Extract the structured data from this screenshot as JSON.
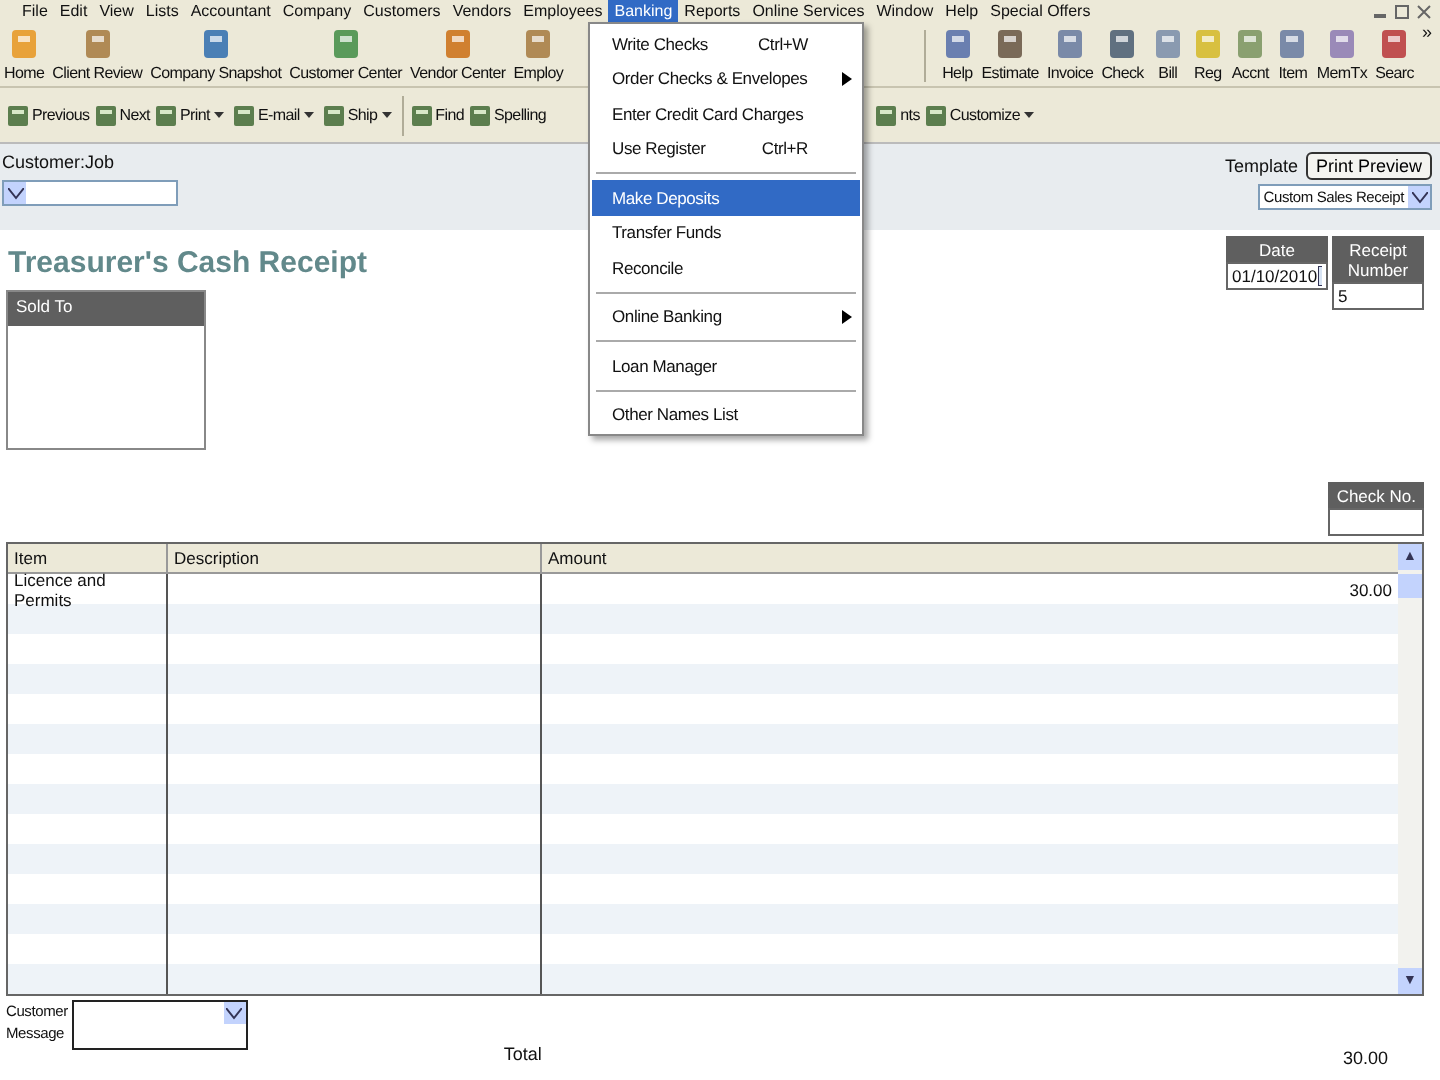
{
  "menu_bar": [
    {
      "label": "File",
      "selected": false
    },
    {
      "label": "Edit",
      "selected": false
    },
    {
      "label": "View",
      "selected": false
    },
    {
      "label": "Lists",
      "selected": false
    },
    {
      "label": "Accountant",
      "selected": false
    },
    {
      "label": "Company",
      "selected": false
    },
    {
      "label": "Customers",
      "selected": false
    },
    {
      "label": "Vendors",
      "selected": false
    },
    {
      "label": "Employees",
      "selected": false
    },
    {
      "label": "Banking",
      "selected": true
    },
    {
      "label": "Reports",
      "selected": false
    },
    {
      "label": "Online Services",
      "selected": false
    },
    {
      "label": "Window",
      "selected": false
    },
    {
      "label": "Help",
      "selected": false
    },
    {
      "label": "Special Offers",
      "selected": false
    }
  ],
  "icon_bar_left": [
    {
      "label": "Home"
    },
    {
      "label": "Client Review"
    },
    {
      "label": "Company Snapshot"
    },
    {
      "label": "Customer Center"
    },
    {
      "label": "Vendor Center"
    },
    {
      "label": "Employ"
    }
  ],
  "icon_bar_right": [
    {
      "label": "Help"
    },
    {
      "label": "Estimate"
    },
    {
      "label": "Invoice"
    },
    {
      "label": "Check"
    },
    {
      "label": "Bill"
    },
    {
      "label": "Reg"
    },
    {
      "label": "Accnt"
    },
    {
      "label": "Item"
    },
    {
      "label": "MemTx"
    },
    {
      "label": "Searc"
    }
  ],
  "overflow_glyph": "»",
  "scroll_arrows": [
    "▲",
    "▼"
  ],
  "form_toolbar": [
    {
      "label": "Previous",
      "dropdown": false
    },
    {
      "label": "Next",
      "dropdown": false
    },
    {
      "label": "Print",
      "dropdown": true
    },
    {
      "label": "E-mail",
      "dropdown": true
    },
    {
      "label": "Ship",
      "dropdown": true
    },
    {
      "label": "Find",
      "dropdown": false
    },
    {
      "label": "Spelling",
      "dropdown": false
    },
    {
      "label": "nts",
      "dropdown": false
    },
    {
      "label": "Customize",
      "dropdown": true
    }
  ],
  "banking_menu": [
    {
      "label": "Write Checks",
      "shortcut": "Ctrl+W",
      "submenu": false,
      "selected": false,
      "separator_before": false
    },
    {
      "label": "Order Checks & Envelopes",
      "submenu": true,
      "selected": false,
      "separator_before": false
    },
    {
      "label": "Enter Credit Card Charges",
      "submenu": false,
      "selected": false,
      "separator_before": false
    },
    {
      "label": "Use Register",
      "shortcut": "Ctrl+R",
      "submenu": false,
      "selected": false,
      "separator_before": false
    },
    {
      "label": "Make Deposits",
      "submenu": false,
      "selected": true,
      "separator_before": true
    },
    {
      "label": "Transfer Funds",
      "submenu": false,
      "selected": false,
      "separator_before": false
    },
    {
      "label": "Reconcile",
      "submenu": false,
      "selected": false,
      "separator_before": false
    },
    {
      "label": "Online Banking",
      "submenu": true,
      "selected": false,
      "separator_before": true
    },
    {
      "label": "Loan Manager",
      "submenu": false,
      "selected": false,
      "separator_before": true
    },
    {
      "label": "Other Names List",
      "submenu": false,
      "selected": false,
      "separator_before": true
    }
  ],
  "form": {
    "customer_job_label": "Customer:Job",
    "template_label": "Template",
    "print_preview": "Print Preview",
    "template_value": "Custom Sales Receipt",
    "title": "Treasurer's Cash Receipt",
    "sold_to_label": "Sold To",
    "date_label": "Date",
    "date_value": "01/10/2010",
    "receipt_number_label": "Receipt Number",
    "receipt_number_value": "5",
    "check_no_label": "Check No.",
    "table": {
      "columns": [
        "Item",
        "Description",
        "Amount"
      ],
      "rows": [
        [
          "Licence and Permits",
          "",
          "30.00"
        ]
      ]
    },
    "customer_message_label": [
      "Customer",
      "Message"
    ],
    "total_label": "Total",
    "total_value": "30.00"
  }
}
